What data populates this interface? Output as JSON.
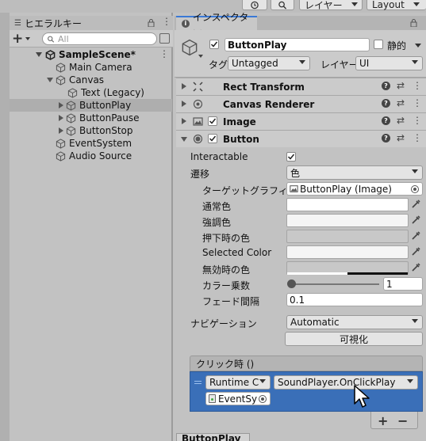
{
  "toolbar": {
    "layers_label": "レイヤー",
    "layout_label": "Layout"
  },
  "hierarchy": {
    "tab_label": "ヒエラルキー",
    "search_placeholder": "All",
    "add_label": "+",
    "scene_name": "SampleScene*",
    "items": [
      {
        "label": "Main Camera"
      },
      {
        "label": "Canvas"
      },
      {
        "label": "Text (Legacy)"
      },
      {
        "label": "ButtonPlay"
      },
      {
        "label": "ButtonPause"
      },
      {
        "label": "ButtonStop"
      },
      {
        "label": "EventSystem"
      },
      {
        "label": "Audio Source"
      }
    ]
  },
  "inspector": {
    "tab_label": "インスペクター",
    "object_name": "ButtonPlay",
    "static_label": "静的",
    "tag_label": "タグ",
    "tag_value": "Untagged",
    "layer_label": "レイヤー",
    "layer_value": "UI",
    "components": [
      {
        "label": "Rect Transform"
      },
      {
        "label": "Canvas Renderer"
      },
      {
        "label": "Image"
      },
      {
        "label": "Button"
      }
    ],
    "button": {
      "interactable_label": "Interactable",
      "transition_label": "遷移",
      "transition_value": "色",
      "target_graphic_label": "ターゲットグラフィックス",
      "target_graphic_value": "ButtonPlay (Image)",
      "normal_color_label": "通常色",
      "highlighted_color_label": "強調色",
      "pressed_color_label": "押下時の色",
      "selected_color_label": "Selected Color",
      "disabled_color_label": "無効時の色",
      "color_multiplier_label": "カラー乗数",
      "color_multiplier_value": "1",
      "fade_duration_label": "フェード間隔",
      "fade_duration_value": "0.1",
      "navigation_label": "ナビゲーション",
      "navigation_value": "Automatic",
      "visualize_label": "可視化",
      "onclick_label": "クリック時 ()",
      "runtime_value": "Runtime C",
      "function_value": "SoundPlayer.OnClickPlay",
      "object_value": "EventSy",
      "add_listener": "+",
      "remove_listener": "−"
    },
    "bottom_label": "ButtonPlay"
  },
  "colors": {
    "selected_row": "#3a6fb8",
    "panel_bg": "#c2c2c2",
    "header_bg": "#cbcbcb"
  }
}
